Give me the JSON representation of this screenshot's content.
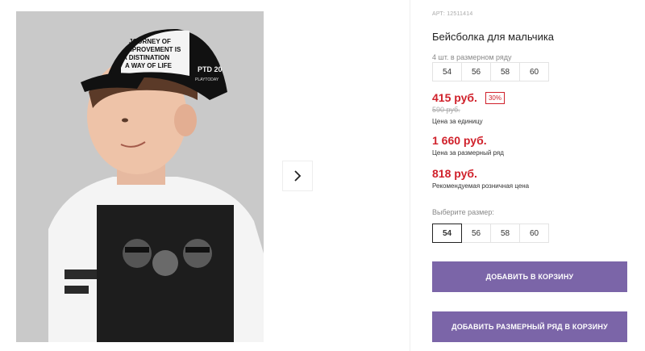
{
  "product": {
    "article": "АРТ: 12511414",
    "title": "Бейсболка для мальчика",
    "cap_text": [
      "JOURNEY OF",
      "IMPROVEMENT IS",
      "A DISTINATION",
      "A WAY OF LIFE"
    ],
    "cap_side_text": "PTD 20",
    "cap_side_sub": "PLAYTODAY"
  },
  "range": {
    "label": "4 шт. в размерном ряду",
    "sizes": [
      "54",
      "56",
      "58",
      "60"
    ]
  },
  "pricing": {
    "price": "415 руб.",
    "discount": "30%",
    "old_price": "590 руб.",
    "unit_note": "Цена за единицу",
    "range_price": "1 660 руб.",
    "range_note": "Цена за размерный ряд",
    "retail_price": "818 руб.",
    "retail_note": "Рекомендуемая розничная цена"
  },
  "size_picker": {
    "label": "Выберите размер:",
    "sizes": [
      "54",
      "56",
      "58",
      "60"
    ],
    "selected": "54"
  },
  "buttons": {
    "add_to_cart": "ДОБАВИТЬ В КОРЗИНУ",
    "add_range_to_cart": "ДОБАВИТЬ РАЗМЕРНЫЙ РЯД В КОРЗИНУ"
  },
  "icons": {
    "next": "chevron-right-icon"
  },
  "colors": {
    "accent_button": "#7b65a8",
    "price_red": "#d0212b"
  }
}
